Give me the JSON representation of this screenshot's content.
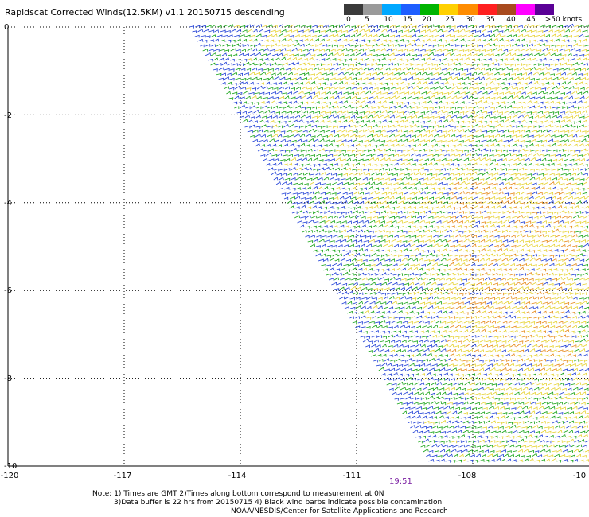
{
  "title": "Rapidscat Corrected Winds(12.5KM) v1.1 20150715 descending",
  "colorbar": {
    "labels": [
      "0",
      "5",
      "10",
      "15",
      "20",
      "25",
      "30",
      "35",
      "40",
      "45",
      ">50 knots"
    ],
    "colors": [
      "#3a3a3a",
      "#9a9a9a",
      "#00a8ff",
      "#1e5eff",
      "#00b400",
      "#ffd000",
      "#ff8c00",
      "#ff2020",
      "#a84a1e",
      "#ff00ff",
      "#5a0096"
    ]
  },
  "map": {
    "lat_ticks": [
      "0",
      "-2",
      "-4",
      "-6",
      "-8",
      "-10"
    ],
    "lon_ticks": [
      "-120",
      "-117",
      "-114",
      "-111",
      "-108",
      "-10"
    ],
    "lat_range": [
      -10,
      0
    ],
    "lon_range": [
      -120,
      -105
    ],
    "grid": true,
    "swath_time": "19:51"
  },
  "notes": {
    "line1": "Note: 1) Times are GMT 2)Times along bottom correspond to measurement at 0N",
    "line2": "3)Data buffer is 22 hrs from 20150715 4) Black wind barbs indicate possible contamination",
    "line3": "NOAA/NESDIS/Center for Satellite Applications and Research"
  }
}
